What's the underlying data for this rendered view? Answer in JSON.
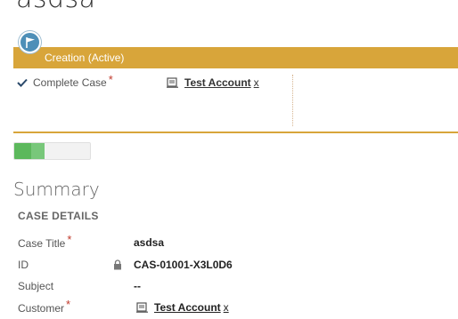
{
  "record": {
    "title": "asdsa"
  },
  "process": {
    "stage_label": "Creation (Active)",
    "step_label": "Complete Case",
    "step_required_marker": "*",
    "step_value": "Test Account",
    "step_value_clear": "x",
    "progress_fraction": 0.4
  },
  "summary": {
    "title": "Summary",
    "section_title": "CASE DETAILS",
    "fields": [
      {
        "label": "Case Title",
        "required_marker": "*",
        "value": "asdsa"
      },
      {
        "label": "ID",
        "value": "CAS-01001-X3L0D6"
      },
      {
        "label": "Subject",
        "value": "--"
      },
      {
        "label": "Customer",
        "required_marker": "*",
        "value": "Test Account",
        "value_clear": "x"
      }
    ]
  },
  "colors": {
    "stage_bar": "#d8a53a",
    "flag_circle": "#4d8fb8",
    "progress_fill": "#5cb85c",
    "required": "#c0392b"
  },
  "icons": {
    "stage_flag": "flag-icon",
    "step_complete": "checkmark-icon",
    "lookup": "lookup-record-icon",
    "locked": "lock-icon"
  }
}
